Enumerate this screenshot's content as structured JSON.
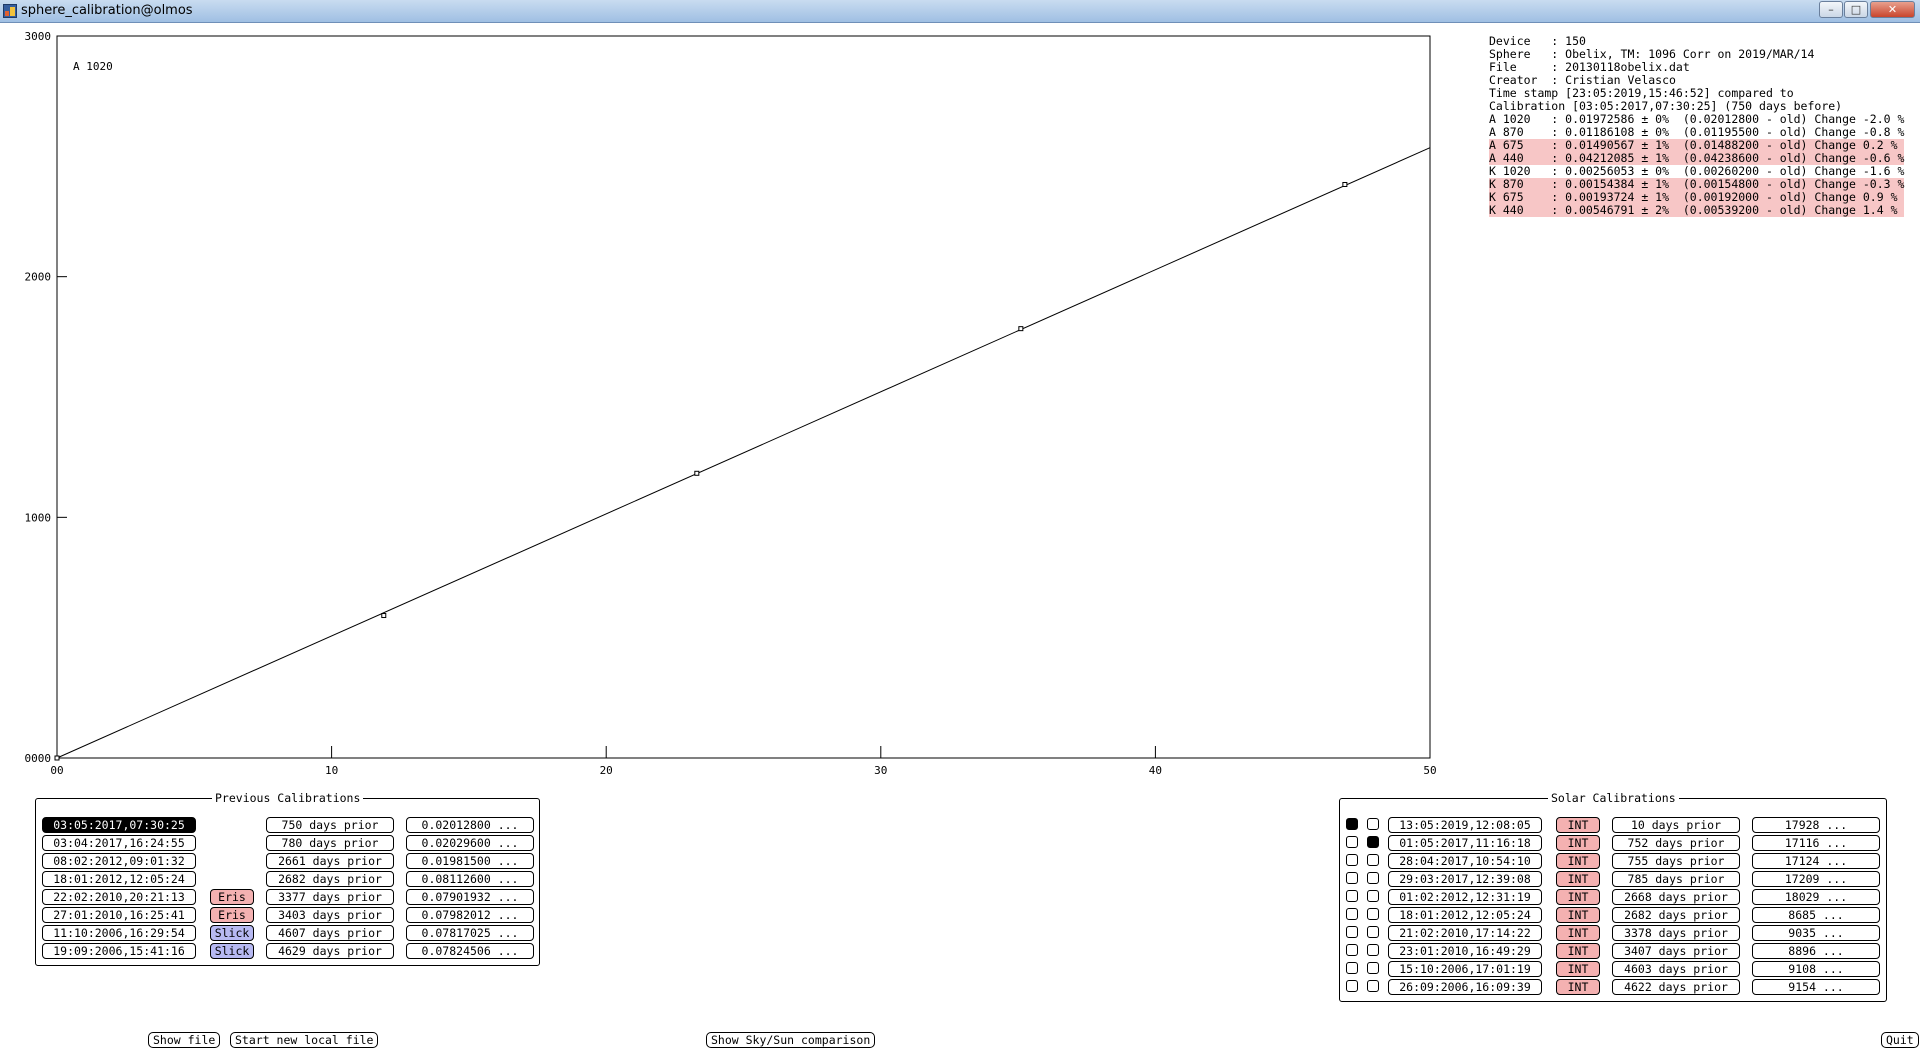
{
  "window": {
    "title": "sphere_calibration@olmos"
  },
  "chart_data": {
    "type": "scatter",
    "annotation": "A 1020",
    "xlim": [
      0,
      50
    ],
    "ylim": [
      0,
      3000
    ],
    "x_ticks": [
      0,
      10,
      20,
      30,
      40,
      50
    ],
    "x_tick_labels": [
      "00",
      "10",
      "20",
      "30",
      "40",
      "50"
    ],
    "y_ticks": [
      0,
      1000,
      2000,
      3000
    ],
    "y_tick_labels": [
      "0000",
      "1000",
      "2000",
      "3000"
    ],
    "points": [
      {
        "x": 0,
        "y": 0
      },
      {
        "x": 11.9,
        "y": 592
      },
      {
        "x": 23.3,
        "y": 1183
      },
      {
        "x": 35.1,
        "y": 1784
      },
      {
        "x": 46.9,
        "y": 2383
      }
    ],
    "fit_line": {
      "x": [
        0,
        50
      ],
      "y": [
        0,
        2536
      ]
    },
    "grid": false,
    "legend": "none"
  },
  "info": {
    "lines": [
      {
        "text": "Device   : 150",
        "hl": false
      },
      {
        "text": "Sphere   : Obelix, TM: 1096 Corr on 2019/MAR/14",
        "hl": false
      },
      {
        "text": "File     : 20130118obelix.dat",
        "hl": false
      },
      {
        "text": "Creator  : Cristian Velasco",
        "hl": false
      },
      {
        "text": "Time stamp [23:05:2019,15:46:52] compared to",
        "hl": false
      },
      {
        "text": "Calibration [03:05:2017,07:30:25] (750 days before)",
        "hl": false
      },
      {
        "text": "A 1020   : 0.01972586 ± 0%  (0.02012800 - old) Change -2.0 %",
        "hl": false
      },
      {
        "text": "A 870    : 0.01186108 ± 0%  (0.01195500 - old) Change -0.8 %",
        "hl": false
      },
      {
        "text": "A 675    : 0.01490567 ± 1%  (0.01488200 - old) Change 0.2 % ",
        "hl": true
      },
      {
        "text": "A 440    : 0.04212085 ± 1%  (0.04238600 - old) Change -0.6 %",
        "hl": true
      },
      {
        "text": "K 1020   : 0.00256053 ± 0%  (0.00260200 - old) Change -1.6 %",
        "hl": false
      },
      {
        "text": "K 870    : 0.00154384 ± 1%  (0.00154800 - old) Change -0.3 %",
        "hl": true
      },
      {
        "text": "K 675    : 0.00193724 ± 1%  (0.00192000 - old) Change 0.9 % ",
        "hl": true
      },
      {
        "text": "K 440    : 0.00546791 ± 2%  (0.00539200 - old) Change 1.4 % ",
        "hl": true
      }
    ]
  },
  "previous_calibrations": {
    "title": "Previous Calibrations",
    "rows": [
      {
        "date": "03:05:2017,07:30:25",
        "tag": "",
        "prior": "750 days prior",
        "value": "0.02012800 ...",
        "selected": true
      },
      {
        "date": "03:04:2017,16:24:55",
        "tag": "",
        "prior": "780 days prior",
        "value": "0.02029600 ...",
        "selected": false
      },
      {
        "date": "08:02:2012,09:01:32",
        "tag": "",
        "prior": "2661 days prior",
        "value": "0.01981500 ...",
        "selected": false
      },
      {
        "date": "18:01:2012,12:05:24",
        "tag": "",
        "prior": "2682 days prior",
        "value": "0.08112600 ...",
        "selected": false
      },
      {
        "date": "22:02:2010,20:21:13",
        "tag": "Eris",
        "prior": "3377 days prior",
        "value": "0.07901932 ...",
        "selected": false
      },
      {
        "date": "27:01:2010,16:25:41",
        "tag": "Eris",
        "prior": "3403 days prior",
        "value": "0.07982012 ...",
        "selected": false
      },
      {
        "date": "11:10:2006,16:29:54",
        "tag": "Slick",
        "prior": "4607 days prior",
        "value": "0.07817025 ...",
        "selected": false
      },
      {
        "date": "19:09:2006,15:41:16",
        "tag": "Slick",
        "prior": "4629 days prior",
        "value": "0.07824506 ...",
        "selected": false
      }
    ]
  },
  "solar_calibrations": {
    "title": "Solar Calibrations",
    "rows": [
      {
        "r1": true,
        "r2": false,
        "date": "13:05:2019,12:08:05",
        "tag": "INT",
        "prior": "10 days prior",
        "value": "17928 ..."
      },
      {
        "r1": false,
        "r2": true,
        "date": "01:05:2017,11:16:18",
        "tag": "INT",
        "prior": "752 days prior",
        "value": "17116 ..."
      },
      {
        "r1": false,
        "r2": false,
        "date": "28:04:2017,10:54:10",
        "tag": "INT",
        "prior": "755 days prior",
        "value": "17124 ..."
      },
      {
        "r1": false,
        "r2": false,
        "date": "29:03:2017,12:39:08",
        "tag": "INT",
        "prior": "785 days prior",
        "value": "17209 ..."
      },
      {
        "r1": false,
        "r2": false,
        "date": "01:02:2012,12:31:19",
        "tag": "INT",
        "prior": "2668 days prior",
        "value": "18029 ..."
      },
      {
        "r1": false,
        "r2": false,
        "date": "18:01:2012,12:05:24",
        "tag": "INT",
        "prior": "2682 days prior",
        "value": "8685 ..."
      },
      {
        "r1": false,
        "r2": false,
        "date": "21:02:2010,17:14:22",
        "tag": "INT",
        "prior": "3378 days prior",
        "value": "9035 ..."
      },
      {
        "r1": false,
        "r2": false,
        "date": "23:01:2010,16:49:29",
        "tag": "INT",
        "prior": "3407 days prior",
        "value": "8896 ..."
      },
      {
        "r1": false,
        "r2": false,
        "date": "15:10:2006,17:01:19",
        "tag": "INT",
        "prior": "4603 days prior",
        "value": "9108 ..."
      },
      {
        "r1": false,
        "r2": false,
        "date": "26:09:2006,16:09:39",
        "tag": "INT",
        "prior": "4622 days prior",
        "value": "9154 ..."
      }
    ]
  },
  "buttons": {
    "show_file": "Show file",
    "start_new_local_file": "Start new local file",
    "show_sky_sun": "Show Sky/Sun comparison",
    "quit": "Quit"
  }
}
